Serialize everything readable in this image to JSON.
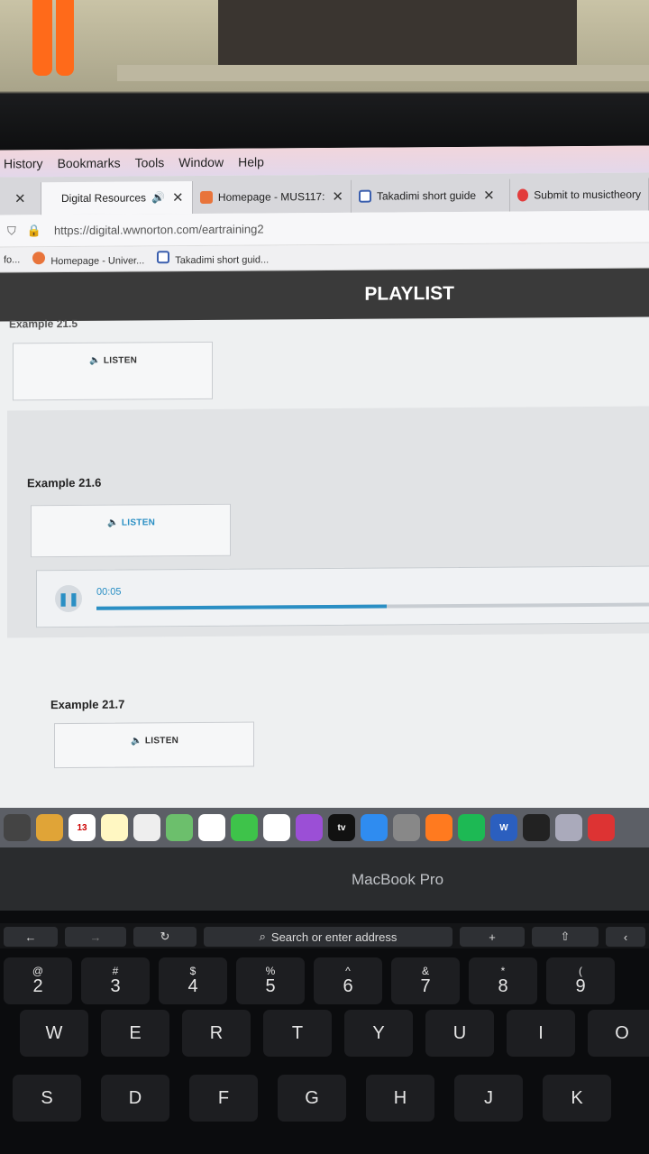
{
  "menubar": {
    "items": [
      "History",
      "Bookmarks",
      "Tools",
      "Window",
      "Help"
    ]
  },
  "tabs": [
    {
      "label": "Digital Resources",
      "active": true,
      "has_audio": true
    },
    {
      "label": "Homepage - MUS117:",
      "active": false
    },
    {
      "label": "Takadimi short guide",
      "active": false
    },
    {
      "label": "Submit to musictheory",
      "active": false
    }
  ],
  "urlbar": {
    "url": "https://digital.wwnorton.com/eartraining2"
  },
  "bookmarks": [
    "fo...",
    "Homepage - Univer...",
    "Takadimi short guid..."
  ],
  "page": {
    "header_title": "PLAYLIST",
    "examples": [
      {
        "title": "Example 21.5",
        "listen_label": "LISTEN",
        "active": false
      },
      {
        "title": "Example 21.6",
        "listen_label": "LISTEN",
        "active": true
      },
      {
        "title": "Example 21.7",
        "listen_label": "LISTEN",
        "active": false
      }
    ],
    "player": {
      "time": "00:05",
      "progress": 0.52
    }
  },
  "dock": {
    "icons": [
      "launchpad-icon",
      "notes-folder-icon",
      "calendar-icon",
      "notes-icon",
      "reminders-icon",
      "maps-icon",
      "photos-icon",
      "facetime-icon",
      "music-icon",
      "podcasts-icon",
      "tv-icon",
      "app-store-icon",
      "system-preferences-icon",
      "firefox-icon",
      "spotify-icon",
      "word-icon",
      "siri-icon",
      "preview-icon",
      "acrobat-icon"
    ],
    "calendar_date": "13",
    "tv_label": "tv",
    "word_label": "W"
  },
  "laptop": {
    "brand": "MacBook Pro"
  },
  "touchbar": {
    "back": "←",
    "forward": "→",
    "reload": "↻",
    "search": "Search or enter address",
    "new_tab": "+",
    "share": "⇧",
    "chevron": "‹"
  },
  "keyboard": {
    "row1": [
      {
        "top": "@",
        "main": "2"
      },
      {
        "top": "#",
        "main": "3"
      },
      {
        "top": "$",
        "main": "4"
      },
      {
        "top": "%",
        "main": "5"
      },
      {
        "top": "^",
        "main": "6"
      },
      {
        "top": "&",
        "main": "7"
      },
      {
        "top": "*",
        "main": "8"
      },
      {
        "top": "(",
        "main": "9"
      }
    ],
    "row2": [
      "W",
      "E",
      "R",
      "T",
      "Y",
      "U",
      "I",
      "O"
    ],
    "row3": [
      "S",
      "D",
      "F",
      "G",
      "H",
      "J",
      "K"
    ]
  },
  "colors": {
    "accent": "#2a8fc4",
    "header_bg": "#3a3a3a"
  }
}
